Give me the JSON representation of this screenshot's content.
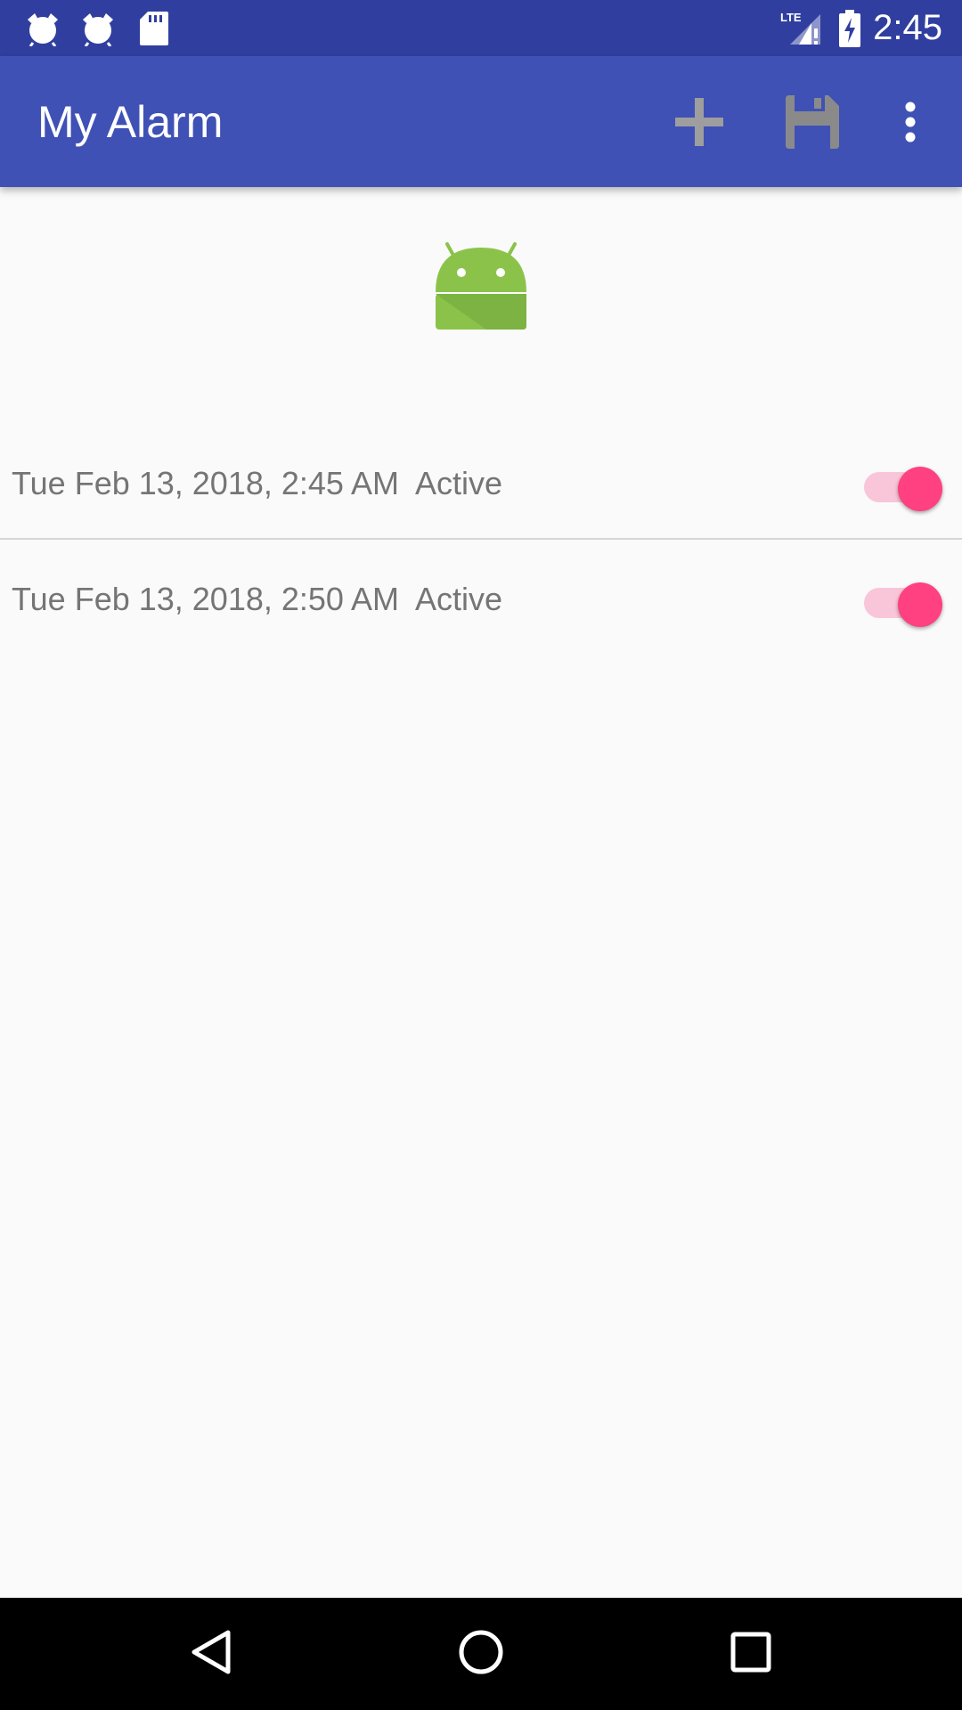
{
  "status_bar": {
    "clock": "2:45",
    "network": "LTE",
    "icons": [
      "alarm-icon",
      "alarm-icon",
      "sd-card-icon",
      "signal-icon",
      "battery-charging-icon"
    ]
  },
  "app_bar": {
    "title": "My Alarm",
    "actions": [
      "add-icon",
      "save-icon",
      "more-vert-icon"
    ]
  },
  "alarms": [
    {
      "datetime": "Tue Feb 13, 2018, 2:45 AM",
      "status": "Active",
      "enabled": true
    },
    {
      "datetime": "Tue Feb 13, 2018, 2:50 AM",
      "status": "Active",
      "enabled": true
    }
  ],
  "nav_bar": {
    "buttons": [
      "back-icon",
      "home-icon",
      "recents-icon"
    ]
  },
  "colors": {
    "status_bar": "#303f9f",
    "app_bar": "#3f51b5",
    "accent": "#ff4081",
    "android_green": "#8bc34a"
  }
}
